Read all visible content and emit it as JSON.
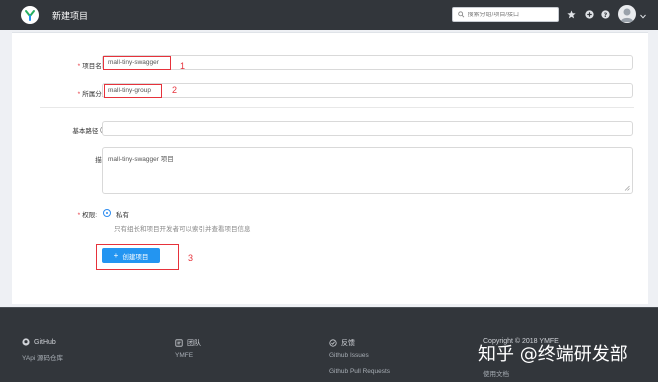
{
  "header": {
    "title": "新建项目",
    "search_placeholder": "搜索分组/项目/接口"
  },
  "form": {
    "project_name": {
      "label": "项目名称:",
      "value": "mall-tiny-swagger",
      "annotation": "1"
    },
    "group": {
      "label": "所属分组:",
      "value": "mall-tiny-group",
      "annotation": "2"
    },
    "base_path": {
      "label": "基本路径",
      "value": ""
    },
    "description": {
      "label": "描述:",
      "value": "mall-tiny-swagger 项目"
    },
    "permission": {
      "label": "权限:",
      "option": "私有",
      "hint": "只有组长和项目开发者可以索引并查看项目信息"
    },
    "create_button": {
      "label": "创建项目",
      "annotation": "3"
    }
  },
  "footer": {
    "columns": [
      {
        "title": "GitHub",
        "links": [
          "YApi 源码仓库"
        ]
      },
      {
        "title": "团队",
        "links": [
          "YMFE"
        ]
      },
      {
        "title": "反馈",
        "links": [
          "Github Issues",
          "Github Pull Requests"
        ]
      },
      {
        "title": "Copyright © 2018 YMFE",
        "links": [
          "使用文档"
        ]
      }
    ]
  },
  "watermark": "知乎 @终端研发部",
  "colors": {
    "topbar": "#32363b",
    "accent": "#2395f1",
    "required": "#e6323b",
    "page_bg": "#eef0f4"
  }
}
